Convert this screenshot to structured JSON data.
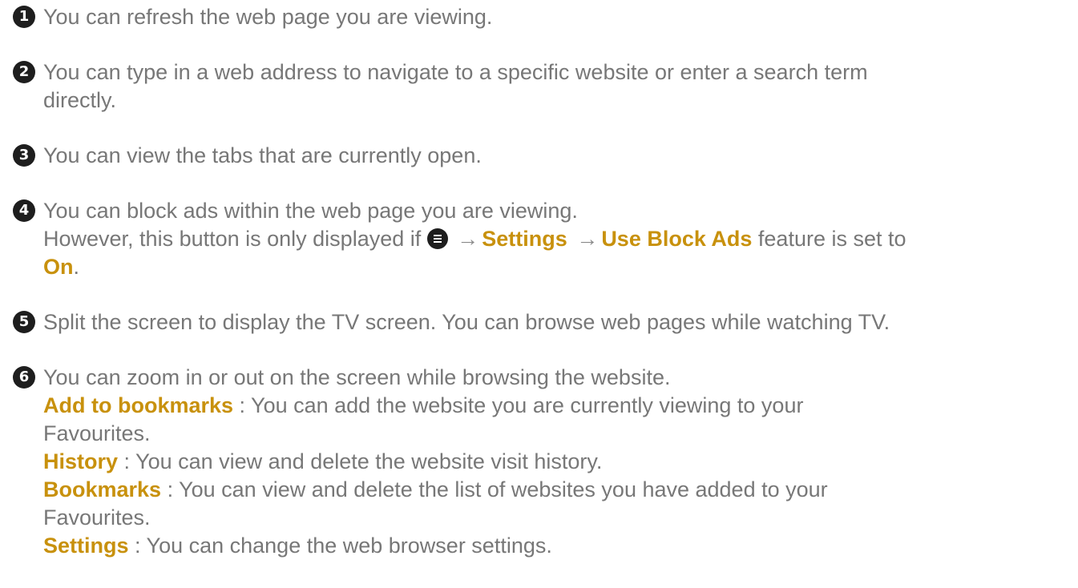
{
  "items": [
    {
      "number": "1",
      "text": "You can refresh the web page you are viewing."
    },
    {
      "number": "2",
      "text_line1": "You can type in a web address to navigate to a specific website or enter a search term",
      "text_line2": "directly."
    },
    {
      "number": "3",
      "text": "You can view the tabs that are currently open."
    },
    {
      "number": "4",
      "text_line1": "You can block ads within the web page you are viewing.",
      "text_line2_prefix": "However, this button is only displayed if",
      "menu_icon": "menu-icon",
      "arrow": "→",
      "settings_link": "Settings",
      "use_block_ads": "Use Block Ads",
      "text_line2_suffix": "feature is set to",
      "on_label": "On",
      "period": "."
    },
    {
      "number": "5",
      "text": "Split the screen to display the TV screen. You can browse web pages while watching TV."
    },
    {
      "number": "6",
      "text": "You can zoom in or out on the screen while browsing the website.",
      "entries": [
        {
          "term": "Add to bookmarks",
          "desc_line1": " : You can add the website you are currently viewing to your",
          "desc_line2": "Favourites."
        },
        {
          "term": "History",
          "desc_line1": " : You can view and delete the website visit history."
        },
        {
          "term": "Bookmarks",
          "desc_line1": " : You can view and delete the list of websites you have added to your",
          "desc_line2": "Favourites."
        },
        {
          "term": "Settings",
          "desc_line1": " : You can change the web browser settings."
        }
      ]
    }
  ],
  "colors": {
    "text": "#777777",
    "highlight": "#c8910d",
    "badge": "#1e1e1e"
  }
}
